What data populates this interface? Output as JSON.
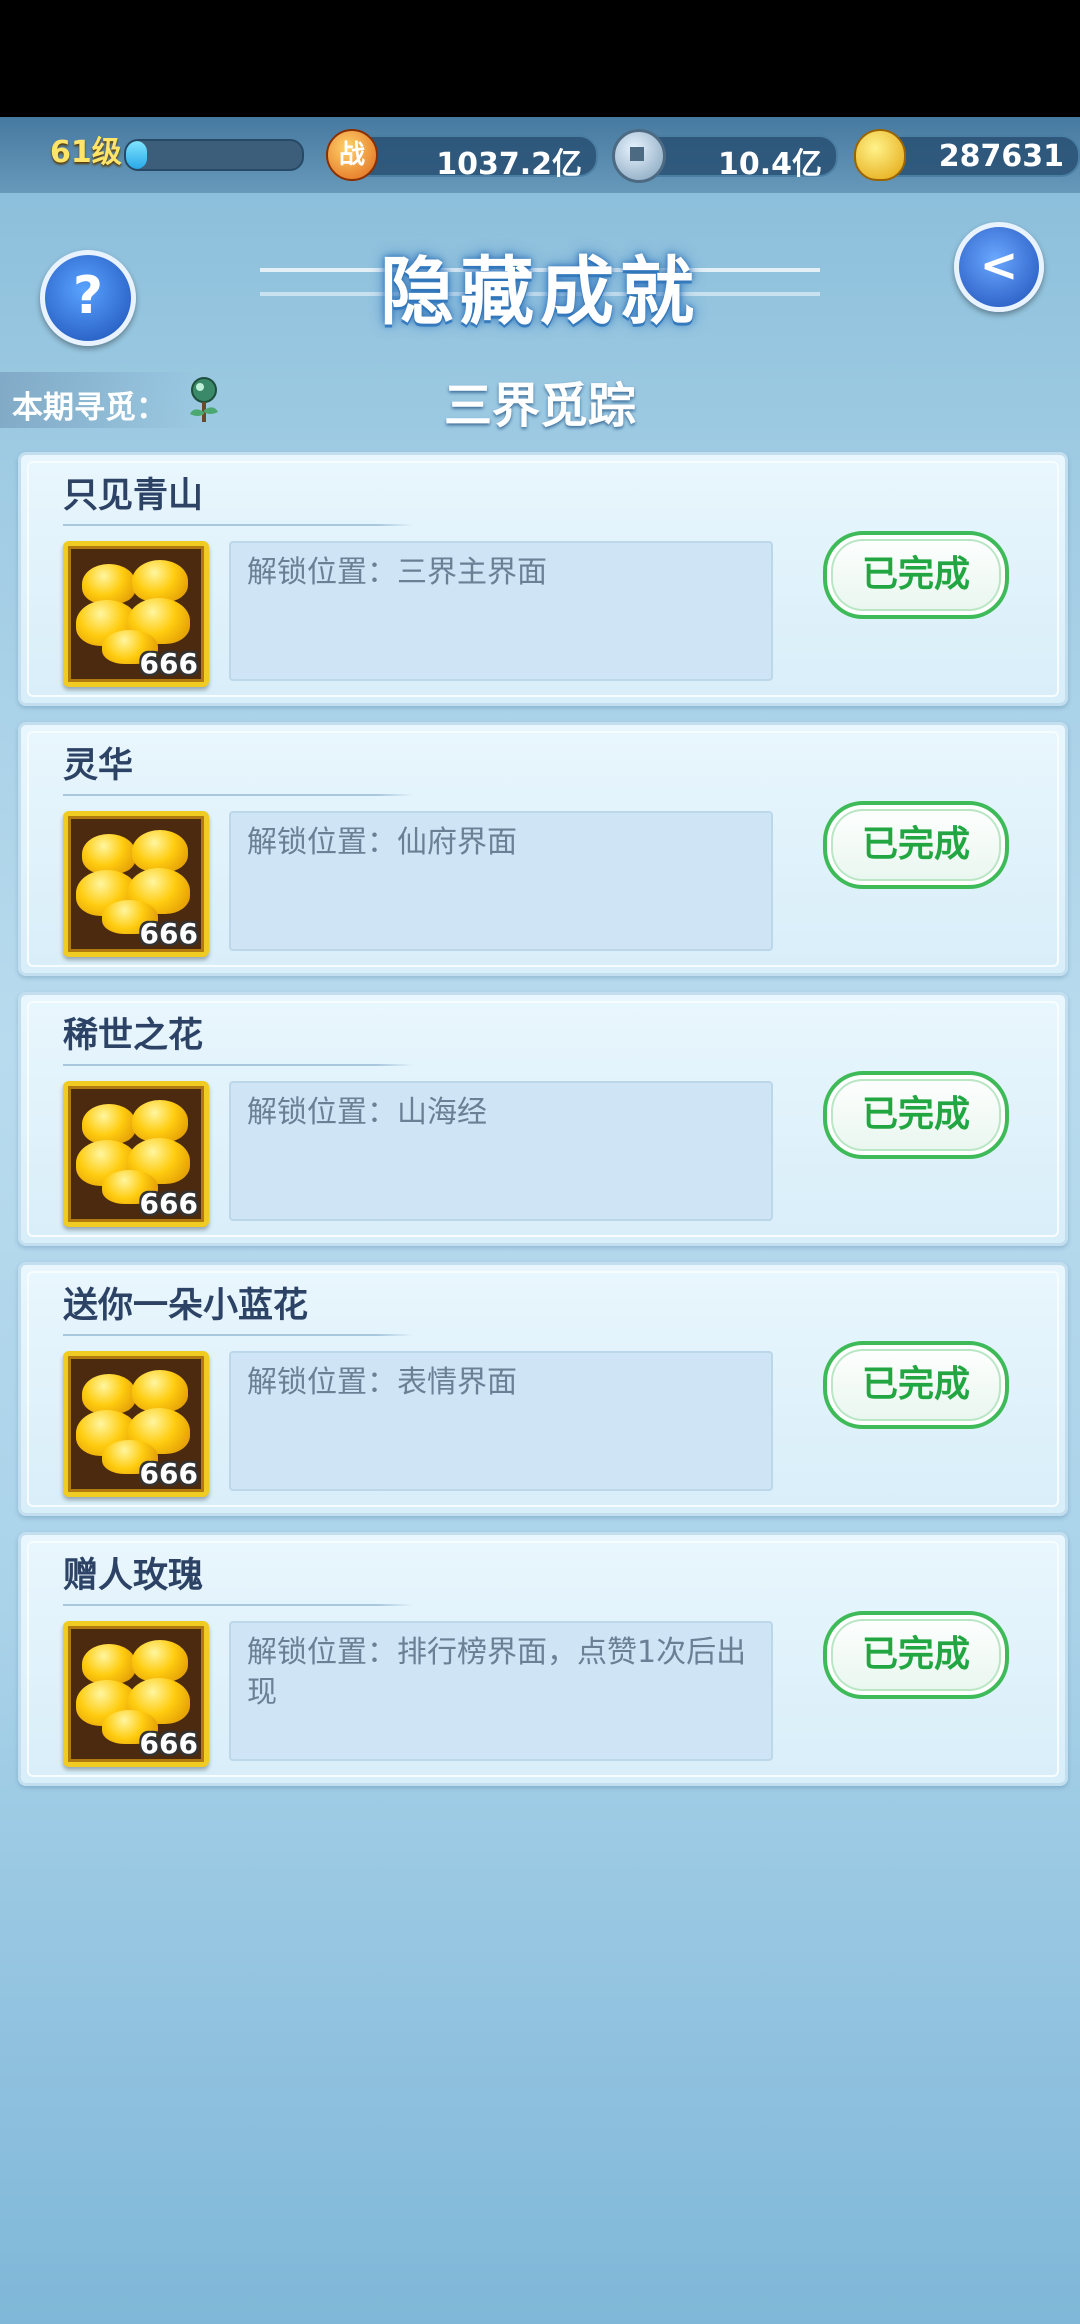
{
  "topbar": {
    "level": "61级",
    "exp_progress": 0.12,
    "power_icon_char": "战",
    "power": "1037.2亿",
    "coins": "10.4亿",
    "ingots": "287631"
  },
  "header": {
    "title": "隐藏成就",
    "help_char": "?",
    "back_char": "<"
  },
  "period": {
    "label": "本期寻觅：",
    "name": "三界觅踪"
  },
  "achievements": [
    {
      "title": "只见青山",
      "reward_count": "666",
      "description": "解锁位置：三界主界面",
      "status": "已完成"
    },
    {
      "title": "灵华",
      "reward_count": "666",
      "description": "解锁位置：仙府界面",
      "status": "已完成"
    },
    {
      "title": "稀世之花",
      "reward_count": "666",
      "description": "解锁位置：山海经",
      "status": "已完成"
    },
    {
      "title": "送你一朵小蓝花",
      "reward_count": "666",
      "description": "解锁位置：表情界面",
      "status": "已完成"
    },
    {
      "title": "赠人玫瑰",
      "reward_count": "666",
      "description": "解锁位置：排行榜界面，点赞1次后出现",
      "status": "已完成"
    }
  ],
  "colors": {
    "accent_green": "#22a642",
    "title_text": "#2d4366",
    "desc_text": "#6b7f95"
  }
}
